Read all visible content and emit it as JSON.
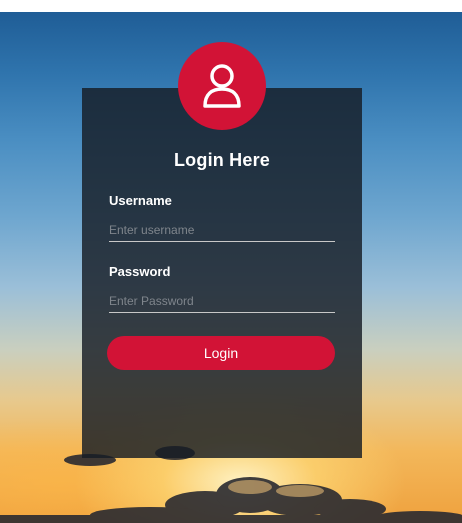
{
  "login": {
    "title": "Login Here",
    "username": {
      "label": "Username",
      "placeholder": "Enter username",
      "value": ""
    },
    "password": {
      "label": "Password",
      "placeholder": "Enter Password",
      "value": ""
    },
    "button_label": "Login"
  },
  "icons": {
    "avatar": "user-icon"
  },
  "colors": {
    "accent": "#d21336",
    "card_background": "#161c24",
    "text": "#ffffff",
    "placeholder": "#7f858c"
  }
}
